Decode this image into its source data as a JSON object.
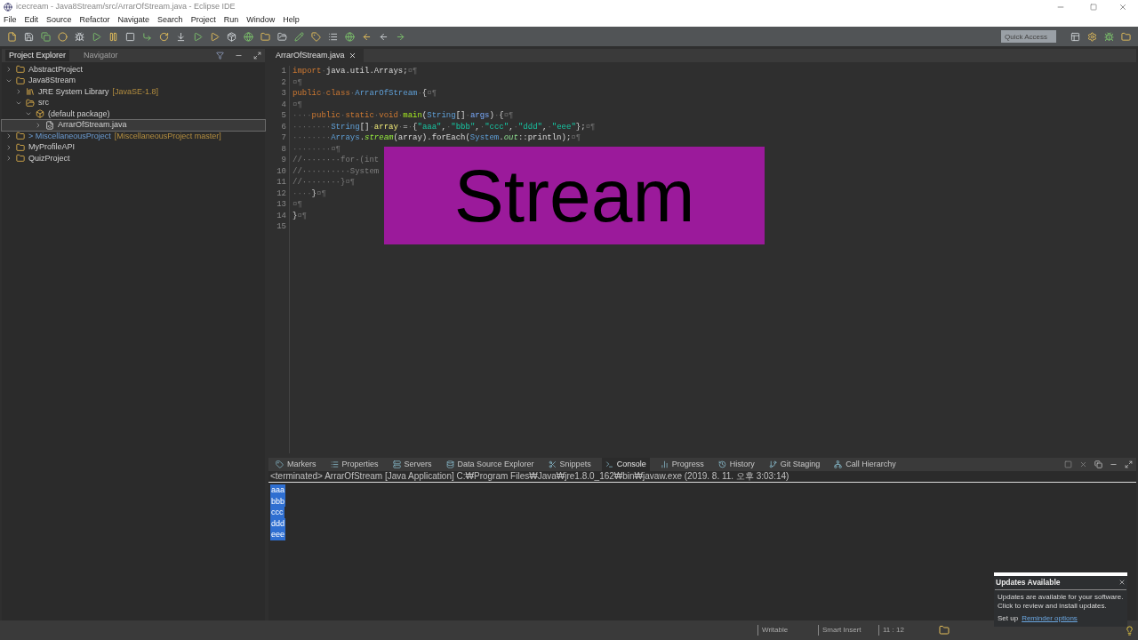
{
  "window": {
    "title": "icecream - Java8Stream/src/ArrarOfStream.java - Eclipse IDE"
  },
  "menu": [
    "File",
    "Edit",
    "Source",
    "Refactor",
    "Navigate",
    "Search",
    "Project",
    "Run",
    "Window",
    "Help"
  ],
  "quick_access": {
    "placeholder": "Quick Access"
  },
  "left_tabs": [
    {
      "label": "Project Explorer",
      "selected": true
    },
    {
      "label": "Navigator",
      "selected": false
    }
  ],
  "tree": [
    {
      "label": "AbstractProject",
      "kind": "project",
      "expanded": false,
      "selected": false
    },
    {
      "label": "Java8Stream",
      "kind": "project",
      "expanded": true,
      "selected": false,
      "children": [
        {
          "label": "JRE System Library",
          "suffix": "[JavaSE-1.8]",
          "kind": "library",
          "expanded": false,
          "selected": false
        },
        {
          "label": "src",
          "kind": "folder",
          "expanded": true,
          "selected": false,
          "children": [
            {
              "label": "(default package)",
              "kind": "package",
              "expanded": true,
              "selected": false,
              "children": [
                {
                  "label": "ArrarOfStream.java",
                  "kind": "file",
                  "expanded": false,
                  "selected": true
                }
              ]
            }
          ]
        }
      ]
    },
    {
      "label": "> MiscellaneousProject",
      "suffix": "[MiscellaneousProject master]",
      "kind": "git",
      "expanded": false,
      "selected": false
    },
    {
      "label": "MyProfileAPI",
      "kind": "project",
      "expanded": false,
      "selected": false
    },
    {
      "label": "QuizProject",
      "kind": "project",
      "expanded": false,
      "selected": false
    }
  ],
  "editor": {
    "tab": "ArrarOfStream.java",
    "lines": [
      {
        "number": "1",
        "tokens": [
          {
            "kind": "keyword",
            "text": "import"
          },
          {
            "kind": "ws",
            "text": "·"
          },
          {
            "kind": "plain",
            "text": "java.util.Arrays;"
          },
          {
            "kind": "ws",
            "text": "¤¶"
          }
        ]
      },
      {
        "number": "2",
        "tokens": [
          {
            "kind": "ws",
            "text": "¤¶"
          }
        ]
      },
      {
        "number": "3",
        "tokens": [
          {
            "kind": "keyword",
            "text": "public"
          },
          {
            "kind": "ws",
            "text": "·"
          },
          {
            "kind": "keyword",
            "text": "class"
          },
          {
            "kind": "ws",
            "text": "·"
          },
          {
            "kind": "type",
            "text": "ArrarOfStream"
          },
          {
            "kind": "ws",
            "text": "·"
          },
          {
            "kind": "plain",
            "text": "{"
          },
          {
            "kind": "ws",
            "text": "¤¶"
          }
        ]
      },
      {
        "number": "4",
        "tokens": [
          {
            "kind": "ws",
            "text": "¤¶"
          }
        ]
      },
      {
        "number": "5",
        "tokens": [
          {
            "kind": "ws",
            "text": "····"
          },
          {
            "kind": "keyword",
            "text": "public"
          },
          {
            "kind": "ws",
            "text": "·"
          },
          {
            "kind": "keyword",
            "text": "static"
          },
          {
            "kind": "ws",
            "text": "·"
          },
          {
            "kind": "keyword",
            "text": "void"
          },
          {
            "kind": "ws",
            "text": "·"
          },
          {
            "kind": "method",
            "text": "main"
          },
          {
            "kind": "plain",
            "text": "("
          },
          {
            "kind": "type",
            "text": "String"
          },
          {
            "kind": "plain",
            "text": "[]"
          },
          {
            "kind": "ws",
            "text": "·"
          },
          {
            "kind": "param",
            "text": "args"
          },
          {
            "kind": "plain",
            "text": ")"
          },
          {
            "kind": "ws",
            "text": "·"
          },
          {
            "kind": "plain",
            "text": "{"
          },
          {
            "kind": "ws",
            "text": "¤¶"
          }
        ]
      },
      {
        "number": "6",
        "tokens": [
          {
            "kind": "ws",
            "text": "········"
          },
          {
            "kind": "type",
            "text": "String"
          },
          {
            "kind": "plain",
            "text": "[]"
          },
          {
            "kind": "ws",
            "text": "·"
          },
          {
            "kind": "var",
            "text": "array"
          },
          {
            "kind": "ws",
            "text": "·"
          },
          {
            "kind": "plain",
            "text": "="
          },
          {
            "kind": "ws",
            "text": "·"
          },
          {
            "kind": "plain",
            "text": "{"
          },
          {
            "kind": "string",
            "text": "\"aaa\""
          },
          {
            "kind": "plain",
            "text": ","
          },
          {
            "kind": "ws",
            "text": "·"
          },
          {
            "kind": "string",
            "text": "\"bbb\""
          },
          {
            "kind": "plain",
            "text": ","
          },
          {
            "kind": "ws",
            "text": "·"
          },
          {
            "kind": "string",
            "text": "\"ccc\""
          },
          {
            "kind": "plain",
            "text": ","
          },
          {
            "kind": "ws",
            "text": "·"
          },
          {
            "kind": "string",
            "text": "\"ddd\""
          },
          {
            "kind": "plain",
            "text": ","
          },
          {
            "kind": "ws",
            "text": "·"
          },
          {
            "kind": "string",
            "text": "\"eee\""
          },
          {
            "kind": "plain",
            "text": "};"
          },
          {
            "kind": "ws",
            "text": "¤¶"
          }
        ]
      },
      {
        "number": "7",
        "tokens": [
          {
            "kind": "ws",
            "text": "········"
          },
          {
            "kind": "type",
            "text": "Arrays"
          },
          {
            "kind": "plain",
            "text": "."
          },
          {
            "kind": "static",
            "text": "stream"
          },
          {
            "kind": "plain",
            "text": "(array).forEach("
          },
          {
            "kind": "type",
            "text": "System"
          },
          {
            "kind": "plain",
            "text": "."
          },
          {
            "kind": "field",
            "text": "out"
          },
          {
            "kind": "plain",
            "text": "::println);"
          },
          {
            "kind": "ws",
            "text": "¤¶"
          }
        ]
      },
      {
        "number": "8",
        "tokens": [
          {
            "kind": "ws",
            "text": "········¤¶"
          }
        ]
      },
      {
        "number": "9",
        "tokens": [
          {
            "kind": "comment",
            "text": "//········for·(int"
          }
        ]
      },
      {
        "number": "10",
        "tokens": [
          {
            "kind": "comment",
            "text": "//··········System"
          }
        ]
      },
      {
        "number": "11",
        "tokens": [
          {
            "kind": "comment",
            "text": "//········}"
          },
          {
            "kind": "ws",
            "text": "¤¶"
          }
        ]
      },
      {
        "number": "12",
        "tokens": [
          {
            "kind": "ws",
            "text": "····"
          },
          {
            "kind": "plain",
            "text": "}"
          },
          {
            "kind": "ws",
            "text": "¤¶"
          }
        ]
      },
      {
        "number": "13",
        "tokens": [
          {
            "kind": "ws",
            "text": "¤¶"
          }
        ]
      },
      {
        "number": "14",
        "tokens": [
          {
            "kind": "plain",
            "text": "}"
          },
          {
            "kind": "ws",
            "text": "¤¶"
          }
        ]
      },
      {
        "number": "15"
      }
    ]
  },
  "caption": "Stream",
  "bottom_tabs": [
    {
      "label": "Markers",
      "selected": false
    },
    {
      "label": "Properties",
      "selected": false
    },
    {
      "label": "Servers",
      "selected": false
    },
    {
      "label": "Data Source Explorer",
      "selected": false
    },
    {
      "label": "Snippets",
      "selected": false
    },
    {
      "label": "Console",
      "selected": true
    },
    {
      "label": "Progress",
      "selected": false
    },
    {
      "label": "History",
      "selected": false
    },
    {
      "label": "Git Staging",
      "selected": false
    },
    {
      "label": "Call Hierarchy",
      "selected": false
    }
  ],
  "console": {
    "header": "<terminated> ArrarOfStream [Java Application] C:₩Program Files₩Java₩jre1.8.0_162₩bin₩javaw.exe (2019. 8. 11. 오후 3:03:14)",
    "output": [
      "aaa",
      "bbb",
      "ccc",
      "ddd",
      "eee"
    ]
  },
  "status_bar": [
    "Writable",
    "Smart Insert",
    "11 : 12"
  ],
  "notification": {
    "title": "Updates Available",
    "body": "Updates are available for your software. Click to review and install updates.",
    "prefix": "Set up",
    "link": "Reminder options"
  }
}
